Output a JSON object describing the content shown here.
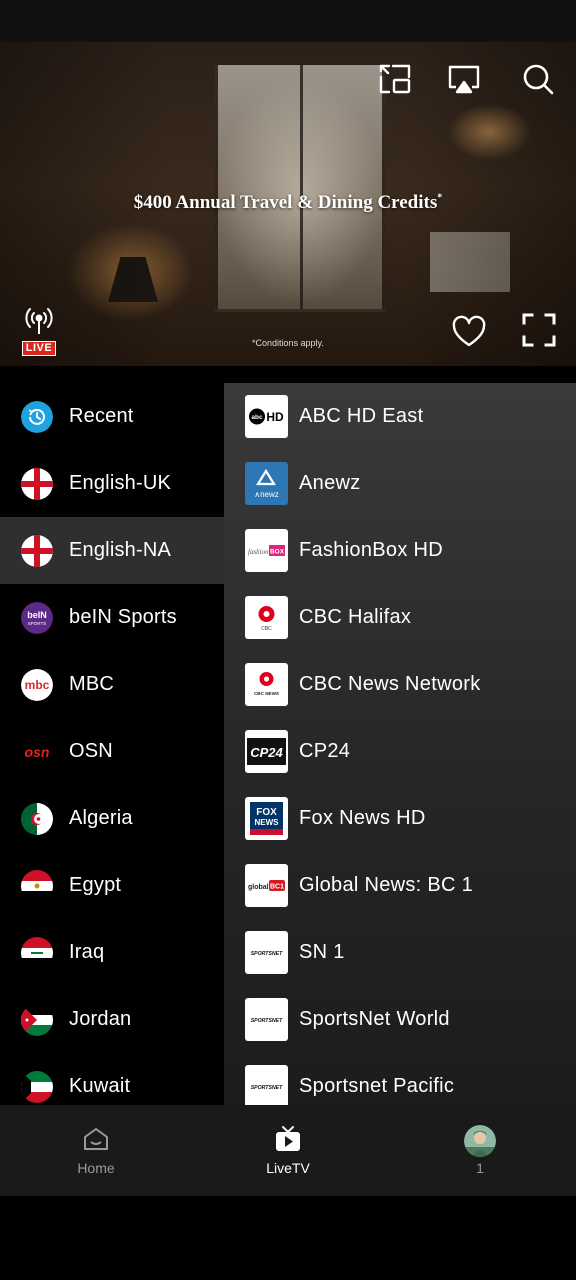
{
  "player": {
    "ad_headline": "$400 Annual Travel & Dining Credits",
    "ad_headline_mark": "*",
    "ad_disclaimer": "*Conditions apply.",
    "live_badge": "LIVE",
    "icons": [
      "picture-in-picture-icon",
      "cast-icon",
      "search-icon",
      "live-broadcast-icon",
      "heart-icon",
      "fullscreen-icon"
    ]
  },
  "categories": [
    {
      "label": "Recent",
      "icon": "recent-icon"
    },
    {
      "label": "English-UK",
      "icon": "england-flag-icon"
    },
    {
      "label": "English-NA",
      "icon": "england-flag-icon",
      "selected": true
    },
    {
      "label": "beIN Sports",
      "icon": "bein-sports-logo-icon"
    },
    {
      "label": "MBC",
      "icon": "mbc-logo-icon"
    },
    {
      "label": "OSN",
      "icon": "osn-logo-icon"
    },
    {
      "label": "Algeria",
      "icon": "algeria-flag-icon"
    },
    {
      "label": "Egypt",
      "icon": "egypt-flag-icon"
    },
    {
      "label": "Iraq",
      "icon": "iraq-flag-icon"
    },
    {
      "label": "Jordan",
      "icon": "jordan-flag-icon"
    },
    {
      "label": "Kuwait",
      "icon": "kuwait-flag-icon"
    }
  ],
  "category_logos": {
    "bein": "beIN",
    "bein_sub": "SPORTS",
    "mbc": "mbc",
    "osn": "osn"
  },
  "channels": [
    {
      "label": "ABC HD East",
      "logo": "ABC HD"
    },
    {
      "label": "Anewz",
      "logo": "Anewz"
    },
    {
      "label": "FashionBox HD",
      "logo": "fashion BOX"
    },
    {
      "label": "CBC Halifax",
      "logo": "CBC"
    },
    {
      "label": "CBC News Network",
      "logo": "CBC NEWS"
    },
    {
      "label": "CP24",
      "logo": "CP24"
    },
    {
      "label": "Fox News HD",
      "logo": "FOX NEWS"
    },
    {
      "label": "Global News: BC 1",
      "logo": "global BC1"
    },
    {
      "label": "SN 1",
      "logo": "SPORTSNET"
    },
    {
      "label": "SportsNet World",
      "logo": "SPORTSNET"
    },
    {
      "label": "Sportsnet Pacific",
      "logo": "SPORTSNET"
    }
  ],
  "channel_logo_text": {
    "abc": "abc",
    "hd": "HD",
    "anewz": "∧newz",
    "fashion": "fashion",
    "box": "BOX",
    "cbc": "CBC",
    "cbc_news": "CBC NEWS",
    "cp24": "CP24",
    "fox": "FOX",
    "news": "NEWS",
    "global": "global",
    "bc1": "BC1",
    "sportsnet": "SPORTSNET"
  },
  "bottom_nav": {
    "items": [
      {
        "label": "Home",
        "icon": "home-icon"
      },
      {
        "label": "LiveTV",
        "icon": "live-tv-icon",
        "active": true
      },
      {
        "label": "1",
        "icon": "profile-avatar"
      }
    ]
  },
  "colors": {
    "selected_row": "#2f2f2f",
    "live_red": "#d6281f",
    "recent_blue": "#1fa3e0",
    "bein_purple": "#5b2a86"
  }
}
